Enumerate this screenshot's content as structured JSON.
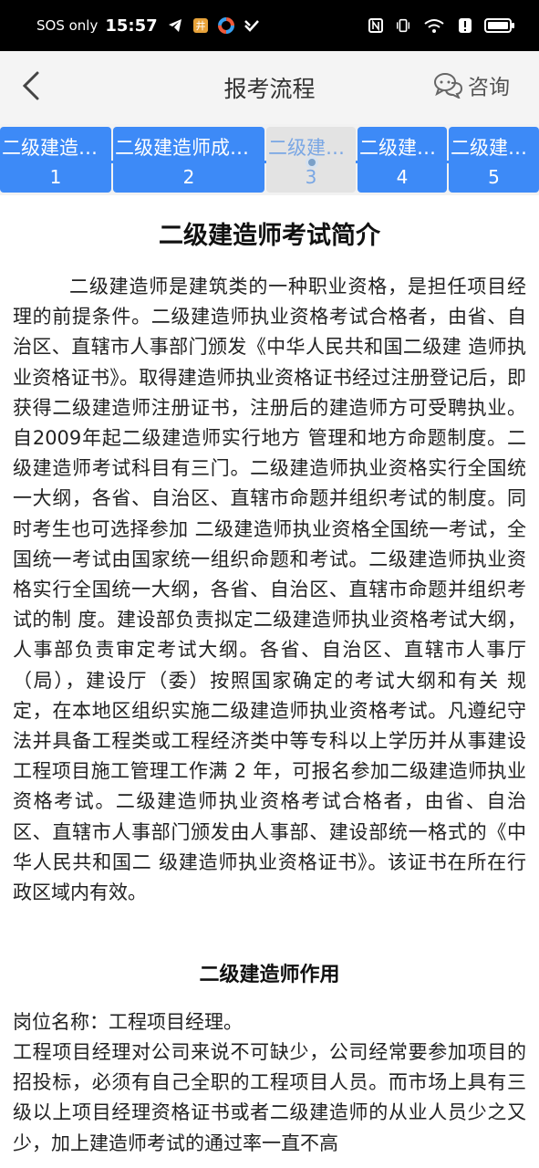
{
  "status": {
    "sos": "SOS only",
    "time": "15:57",
    "icons": [
      "telegram-icon",
      "app-badge-icon",
      "color-wheel-icon",
      "vpn-icon",
      "nfc-icon",
      "vibrate-icon",
      "wifi-icon",
      "alert-icon",
      "battery-icon"
    ],
    "wifi_label": "6"
  },
  "nav": {
    "back_icon": "chevron-left-icon",
    "title": "报考流程",
    "consult_label": "咨询",
    "consult_icon": "chat-bubble-icon"
  },
  "steps": [
    {
      "title": "二级建造师报考条件",
      "number": "1",
      "active": false
    },
    {
      "title": "二级建造师成绩查询",
      "number": "2",
      "active": false
    },
    {
      "title": "二级建造师考试简介",
      "number": "3",
      "active": true
    },
    {
      "title": "二级建造师报名流程",
      "number": "4",
      "active": false
    },
    {
      "title": "二级建造师证书领取",
      "number": "5",
      "active": false
    }
  ],
  "article": {
    "title": "二级建造师考试简介",
    "intro": "二级建造师是建筑类的一种职业资格，是担任项目经理的前提条件。二级建造师执业资格考试合格者，由省、自治区、直辖市人事部门颁发《中华人民共和国二级建 造师执业资格证书》。取得建造师执业资格证书经过注册登记后，即获得二级建造师注册证书，注册后的建造师方可受聘执业。自2009年起二级建造师实行地方 管理和地方命题制度。二级建造师考试科目有三门。二级建造师执业资格实行全国统一大纲，各省、自治区、直辖市命题并组织考试的制度。同时考生也可选择参加 二级建造师执业资格全国统一考试，全国统一考试由国家统一组织命题和考试。二级建造师执业资格实行全国统一大纲，各省、自治区、直辖市命题并组织考试的制 度。建设部负责拟定二级建造师执业资格考试大纲，人事部负责审定考试大纲。各省、自治区、直辖市人事厅（局），建设厅（委）按照国家确定的考试大纲和有关 规定，在本地区组织实施二级建造师执业资格考试。凡遵纪守法并具备工程类或工程经济类中等专科以上学历并从事建设工程项目施工管理工作满 2 年，可报名参加二级建造师执业资格考试。二级建造师执业资格考试合格者，由省、自治区、直辖市人事部门颁发由人事部、建设部统一格式的《中华人民共和国二 级建造师执业资格证书》。该证书在所在行政区域内有效。",
    "section_title": "二级建造师作用",
    "position_line": "岗位名称：工程项目经理。",
    "role_text": "工程项目经理对公司来说不可缺少，公司经常要参加项目的招投标，必须有自己全职的工程项目人员。而市场上具有三级以上项目经理资格证书或者二级建造师的从业人员少之又少，加上建造师考试的通过率一直不高"
  },
  "colors": {
    "accent": "#3d8af7",
    "active_tab_bg": "#e3e3e3",
    "active_tab_text": "#7aa7e4",
    "nav_bg": "#f4f4f4"
  }
}
